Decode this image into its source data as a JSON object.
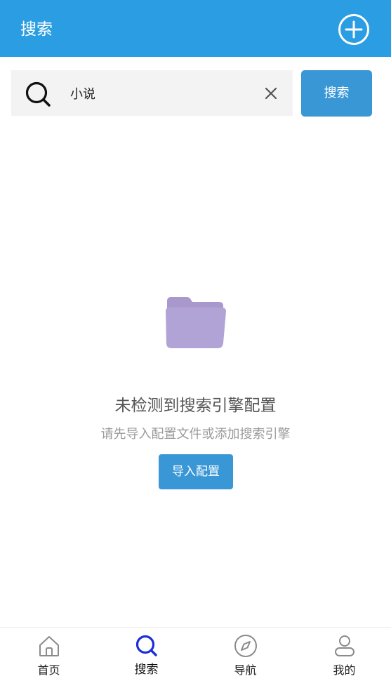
{
  "header": {
    "title": "搜索",
    "add_icon": "plus-circle-icon"
  },
  "search": {
    "value": "小说",
    "placeholder": "",
    "button_label": "搜索",
    "icon": "search-icon",
    "clear_icon": "close-icon"
  },
  "empty_state": {
    "icon": "folder-icon",
    "title": "未检测到搜索引擎配置",
    "description": "请先导入配置文件或添加搜索引擎",
    "button_label": "导入配置"
  },
  "tabbar": {
    "tabs": [
      {
        "label": "首页",
        "icon": "home-icon",
        "active": false
      },
      {
        "label": "搜索",
        "icon": "search-icon",
        "active": true
      },
      {
        "label": "导航",
        "icon": "compass-icon",
        "active": false
      },
      {
        "label": "我的",
        "icon": "user-icon",
        "active": false
      }
    ]
  },
  "colors": {
    "header_bg": "#2b9de2",
    "button_bg": "#3a97d6",
    "folder": "#b2a3d6",
    "active_tab": "#1b2fd8",
    "inactive_tab": "#8a8a8a"
  }
}
